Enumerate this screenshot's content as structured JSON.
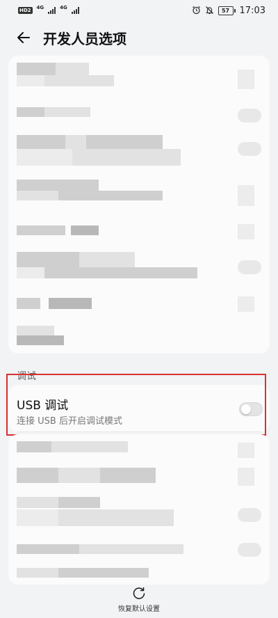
{
  "status_bar": {
    "hd_badge": "HD2",
    "network_1": "4G",
    "network_2": "4G",
    "battery_level": "57",
    "time": "17:03",
    "icons": [
      "alarm-icon",
      "mute-bell-icon"
    ]
  },
  "header": {
    "title": "开发人员选项",
    "back_icon": "arrow-left-icon"
  },
  "debug_section": {
    "label": "调试",
    "usb_debug": {
      "title": "USB 调试",
      "subtitle": "连接 USB 后开启调试模式",
      "enabled": false
    }
  },
  "footer": {
    "restore_label": "恢复默认设置",
    "restore_icon": "restore-icon"
  },
  "colors": {
    "background": "#f1f3f5",
    "card": "#fbfbfb",
    "highlight_border": "#d93030",
    "secondary_text": "#777777"
  }
}
